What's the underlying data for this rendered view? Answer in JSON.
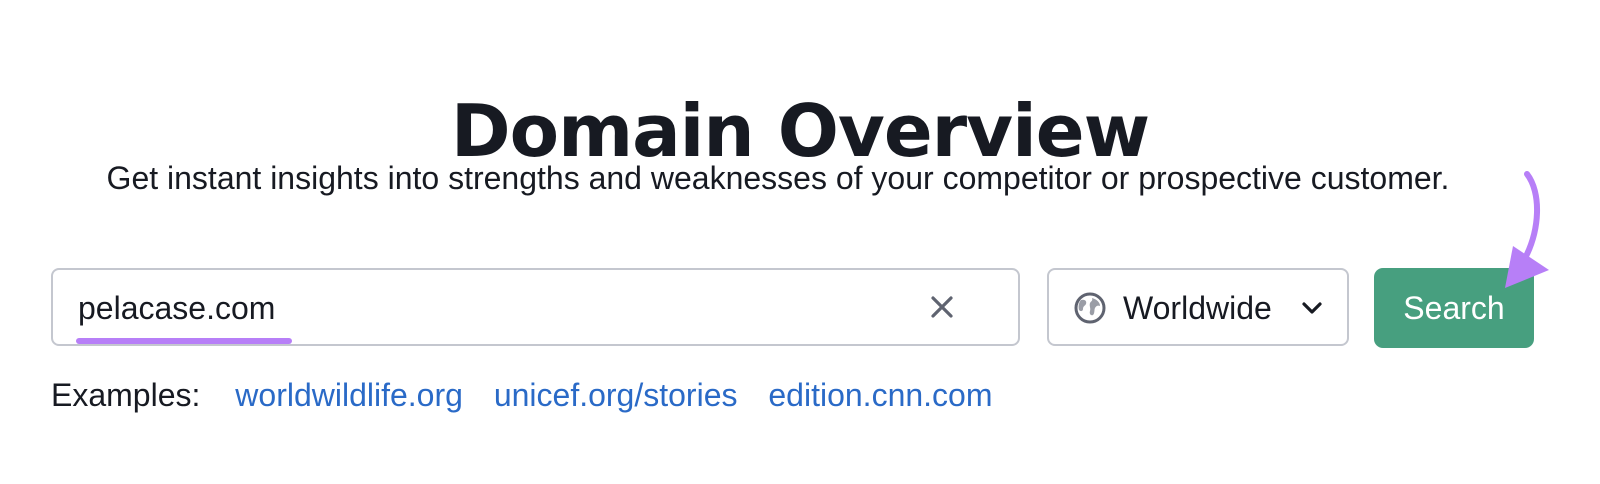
{
  "page": {
    "title": "Domain Overview",
    "subtitle": "Get instant insights into strengths and weaknesses of your competitor or prospective customer."
  },
  "search": {
    "value": "pelacase.com",
    "clear_icon": "close-icon",
    "region": {
      "label": "Worldwide",
      "icon": "globe-icon",
      "dropdown_icon": "chevron-down-icon"
    },
    "button_label": "Search"
  },
  "examples": {
    "label": "Examples:",
    "links": [
      "worldwildlife.org",
      "unicef.org/stories",
      "edition.cnn.com"
    ]
  },
  "annotations": {
    "arrow_icon": "curved-arrow-icon",
    "underline": "highlight-underline"
  },
  "colors": {
    "text": "#171a22",
    "link": "#2a6ac7",
    "button": "#479f7f",
    "accent": "#b77ff7",
    "border": "#c4c7cf",
    "icon": "#5f6370"
  }
}
